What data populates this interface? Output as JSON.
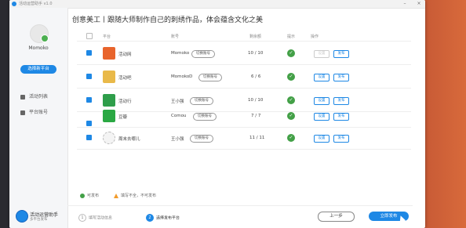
{
  "window": {
    "title": "活动运营助手 v1.0"
  },
  "sidebar": {
    "username": "Momoko",
    "select_button": "选择新平台",
    "nav": [
      {
        "label": "活动列表",
        "icon": "list-icon"
      },
      {
        "label": "平台账号",
        "icon": "user-icon"
      }
    ],
    "logo_title": "活动运营助手",
    "logo_sub": "多平台发布"
  },
  "header": {
    "text": "创意美工丨跟随大师制作自己的刺绣作品，体会蕴含文化之美"
  },
  "table": {
    "columns": [
      "平台",
      "账号",
      "剩余额",
      "提示",
      "操作"
    ],
    "rows": [
      {
        "checked": true,
        "platform": "活动网",
        "account": "Momoko",
        "switch": "切换账号",
        "count": "10 / 10",
        "ok": true,
        "actions": [
          "设置",
          "发布"
        ],
        "first_disabled": true,
        "color": "#e8642c"
      },
      {
        "checked": true,
        "platform": "活动吧",
        "account": "MomokoD",
        "switch": "切换账号",
        "count": "6 / 6",
        "ok": true,
        "actions": [
          "设置",
          "发布"
        ],
        "first_disabled": false,
        "color": "#e9b949"
      },
      {
        "checked": true,
        "platform": "活动行",
        "account": "王小强",
        "switch": "切换账号",
        "count": "10 / 10",
        "ok": true,
        "actions": [
          "设置",
          "发布"
        ],
        "first_disabled": false,
        "color": "#2e9e4a"
      },
      {
        "checked": true,
        "platform": "豆瓣",
        "account": "Comou",
        "switch": "切换账号",
        "count": "7 / 7",
        "ok": true,
        "actions": [
          "设置",
          "发布"
        ],
        "first_disabled": false,
        "color": "#2aa843"
      },
      {
        "checked": true,
        "platform": "周末去哪儿",
        "account": "王小强",
        "switch": "切换账号",
        "count": "11 / 11",
        "ok": true,
        "actions": [
          "设置",
          "发布"
        ],
        "first_disabled": false,
        "color": "#cccccc"
      }
    ]
  },
  "legend": {
    "ok": "可发布",
    "warn": "填写不全，不可发布"
  },
  "steps": [
    {
      "num": "1",
      "label": "填写活动信息"
    },
    {
      "num": "2",
      "label": "选择发布平台"
    }
  ],
  "buttons": {
    "prev": "上一步",
    "next": "立即发布"
  }
}
